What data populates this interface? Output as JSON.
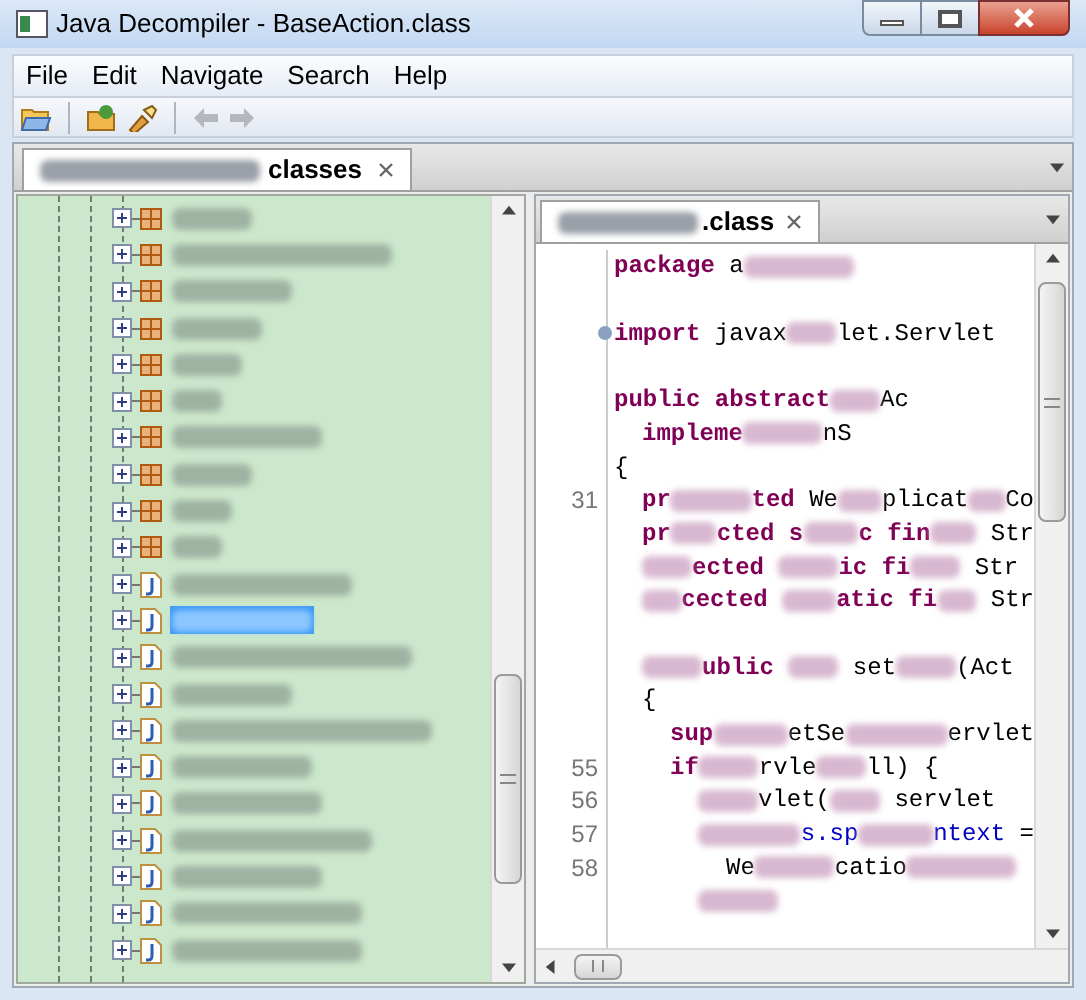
{
  "window": {
    "title": "Java Decompiler - BaseAction.class"
  },
  "menu": [
    "File",
    "Edit",
    "Navigate",
    "Search",
    "Help"
  ],
  "toolbar": [
    {
      "kind": "open",
      "disabled": false
    },
    {
      "kind": "separator"
    },
    {
      "kind": "open-type",
      "disabled": false
    },
    {
      "kind": "search",
      "disabled": false
    },
    {
      "kind": "separator"
    },
    {
      "kind": "back",
      "disabled": true
    },
    {
      "kind": "forward",
      "disabled": true
    }
  ],
  "left_tab": {
    "title": "classes",
    "selected": true
  },
  "tree": [
    {
      "kind": "package",
      "selected": false
    },
    {
      "kind": "package",
      "selected": false
    },
    {
      "kind": "package",
      "selected": false
    },
    {
      "kind": "package",
      "selected": false
    },
    {
      "kind": "package",
      "selected": false
    },
    {
      "kind": "package",
      "selected": false
    },
    {
      "kind": "package",
      "selected": false
    },
    {
      "kind": "package",
      "selected": false
    },
    {
      "kind": "package",
      "selected": false
    },
    {
      "kind": "package",
      "selected": false
    },
    {
      "kind": "class",
      "selected": false
    },
    {
      "kind": "class",
      "selected": true
    },
    {
      "kind": "class",
      "selected": false
    },
    {
      "kind": "class",
      "selected": false
    },
    {
      "kind": "class",
      "selected": false
    },
    {
      "kind": "class",
      "selected": false
    },
    {
      "kind": "class",
      "selected": false
    },
    {
      "kind": "class",
      "selected": false
    },
    {
      "kind": "class",
      "selected": false
    },
    {
      "kind": "class",
      "selected": false
    },
    {
      "kind": "class",
      "selected": false
    }
  ],
  "right_tab": {
    "title": ".class",
    "selected": true
  },
  "code": [
    {
      "segments": [
        {
          "kind": "keyword",
          "text": "package"
        },
        {
          "kind": "plain",
          "text": " a"
        },
        {
          "kind": "redacted"
        }
      ]
    },
    {
      "fold": true,
      "segments": [
        {
          "kind": "keyword",
          "text": "import"
        },
        {
          "kind": "plain",
          "text": " javax"
        },
        {
          "kind": "redacted"
        },
        {
          "kind": "plain",
          "text": "let.Servlet"
        }
      ]
    },
    {
      "segments": [
        {
          "kind": "keyword",
          "text": "public abstract"
        },
        {
          "kind": "redacted"
        },
        {
          "kind": "plain",
          "text": "Ac"
        }
      ]
    },
    {
      "segments": [
        {
          "kind": "keyword",
          "text": "impleme"
        },
        {
          "kind": "redacted"
        },
        {
          "kind": "plain",
          "text": "nS"
        }
      ]
    },
    {
      "segments": [
        {
          "kind": "plain",
          "text": "{"
        }
      ]
    },
    {
      "number": "31",
      "segments": [
        {
          "kind": "keyword",
          "text": "pr"
        },
        {
          "kind": "redacted"
        },
        {
          "kind": "keyword",
          "text": "ted"
        },
        {
          "kind": "plain",
          "text": " We"
        },
        {
          "kind": "redacted"
        },
        {
          "kind": "plain",
          "text": "plicat"
        },
        {
          "kind": "redacted"
        },
        {
          "kind": "plain",
          "text": "Co"
        }
      ]
    },
    {
      "segments": [
        {
          "kind": "keyword",
          "text": "pr"
        },
        {
          "kind": "redacted"
        },
        {
          "kind": "keyword",
          "text": "cted s"
        },
        {
          "kind": "redacted"
        },
        {
          "kind": "keyword",
          "text": "c fin"
        },
        {
          "kind": "redacted"
        },
        {
          "kind": "plain",
          "text": " Str"
        }
      ]
    },
    {
      "segments": [
        {
          "kind": "redacted"
        },
        {
          "kind": "keyword",
          "text": "ected "
        },
        {
          "kind": "redacted"
        },
        {
          "kind": "keyword",
          "text": "ic fi"
        },
        {
          "kind": "redacted"
        },
        {
          "kind": "plain",
          "text": " Str"
        }
      ]
    },
    {
      "segments": [
        {
          "kind": "redacted"
        },
        {
          "kind": "keyword",
          "text": "cected "
        },
        {
          "kind": "redacted"
        },
        {
          "kind": "keyword",
          "text": "atic fi"
        },
        {
          "kind": "redacted"
        },
        {
          "kind": "plain",
          "text": " Str"
        }
      ]
    },
    {
      "segments": [
        {
          "kind": "redacted"
        },
        {
          "kind": "keyword",
          "text": "ublic "
        },
        {
          "kind": "redacted"
        },
        {
          "kind": "plain",
          "text": " set"
        },
        {
          "kind": "redacted"
        },
        {
          "kind": "plain",
          "text": "(Act"
        }
      ]
    },
    {
      "segments": [
        {
          "kind": "plain",
          "text": "{"
        }
      ]
    },
    {
      "segments": [
        {
          "kind": "keyword",
          "text": "sup"
        },
        {
          "kind": "redacted"
        },
        {
          "kind": "plain",
          "text": "etSe"
        },
        {
          "kind": "redacted"
        },
        {
          "kind": "plain",
          "text": "ervlet"
        }
      ]
    },
    {
      "number": "55",
      "segments": [
        {
          "kind": "keyword",
          "text": "if"
        },
        {
          "kind": "redacted"
        },
        {
          "kind": "plain",
          "text": "rvle"
        },
        {
          "kind": "redacted"
        },
        {
          "kind": "plain",
          "text": "ll) {"
        }
      ]
    },
    {
      "number": "56",
      "segments": [
        {
          "kind": "redacted"
        },
        {
          "kind": "plain",
          "text": "vlet("
        },
        {
          "kind": "redacted"
        },
        {
          "kind": "plain",
          "text": " servlet"
        }
      ]
    },
    {
      "number": "57",
      "segments": [
        {
          "kind": "redacted"
        },
        {
          "kind": "field",
          "text": "s.sp"
        },
        {
          "kind": "redacted"
        },
        {
          "kind": "field",
          "text": "ntext"
        },
        {
          "kind": "plain",
          "text": " ="
        }
      ]
    },
    {
      "number": "58",
      "segments": [
        {
          "kind": "plain",
          "text": "We"
        },
        {
          "kind": "redacted"
        },
        {
          "kind": "plain",
          "text": "catio"
        },
        {
          "kind": "redacted"
        }
      ]
    },
    {
      "segments": [
        {
          "kind": "redacted"
        }
      ]
    }
  ]
}
